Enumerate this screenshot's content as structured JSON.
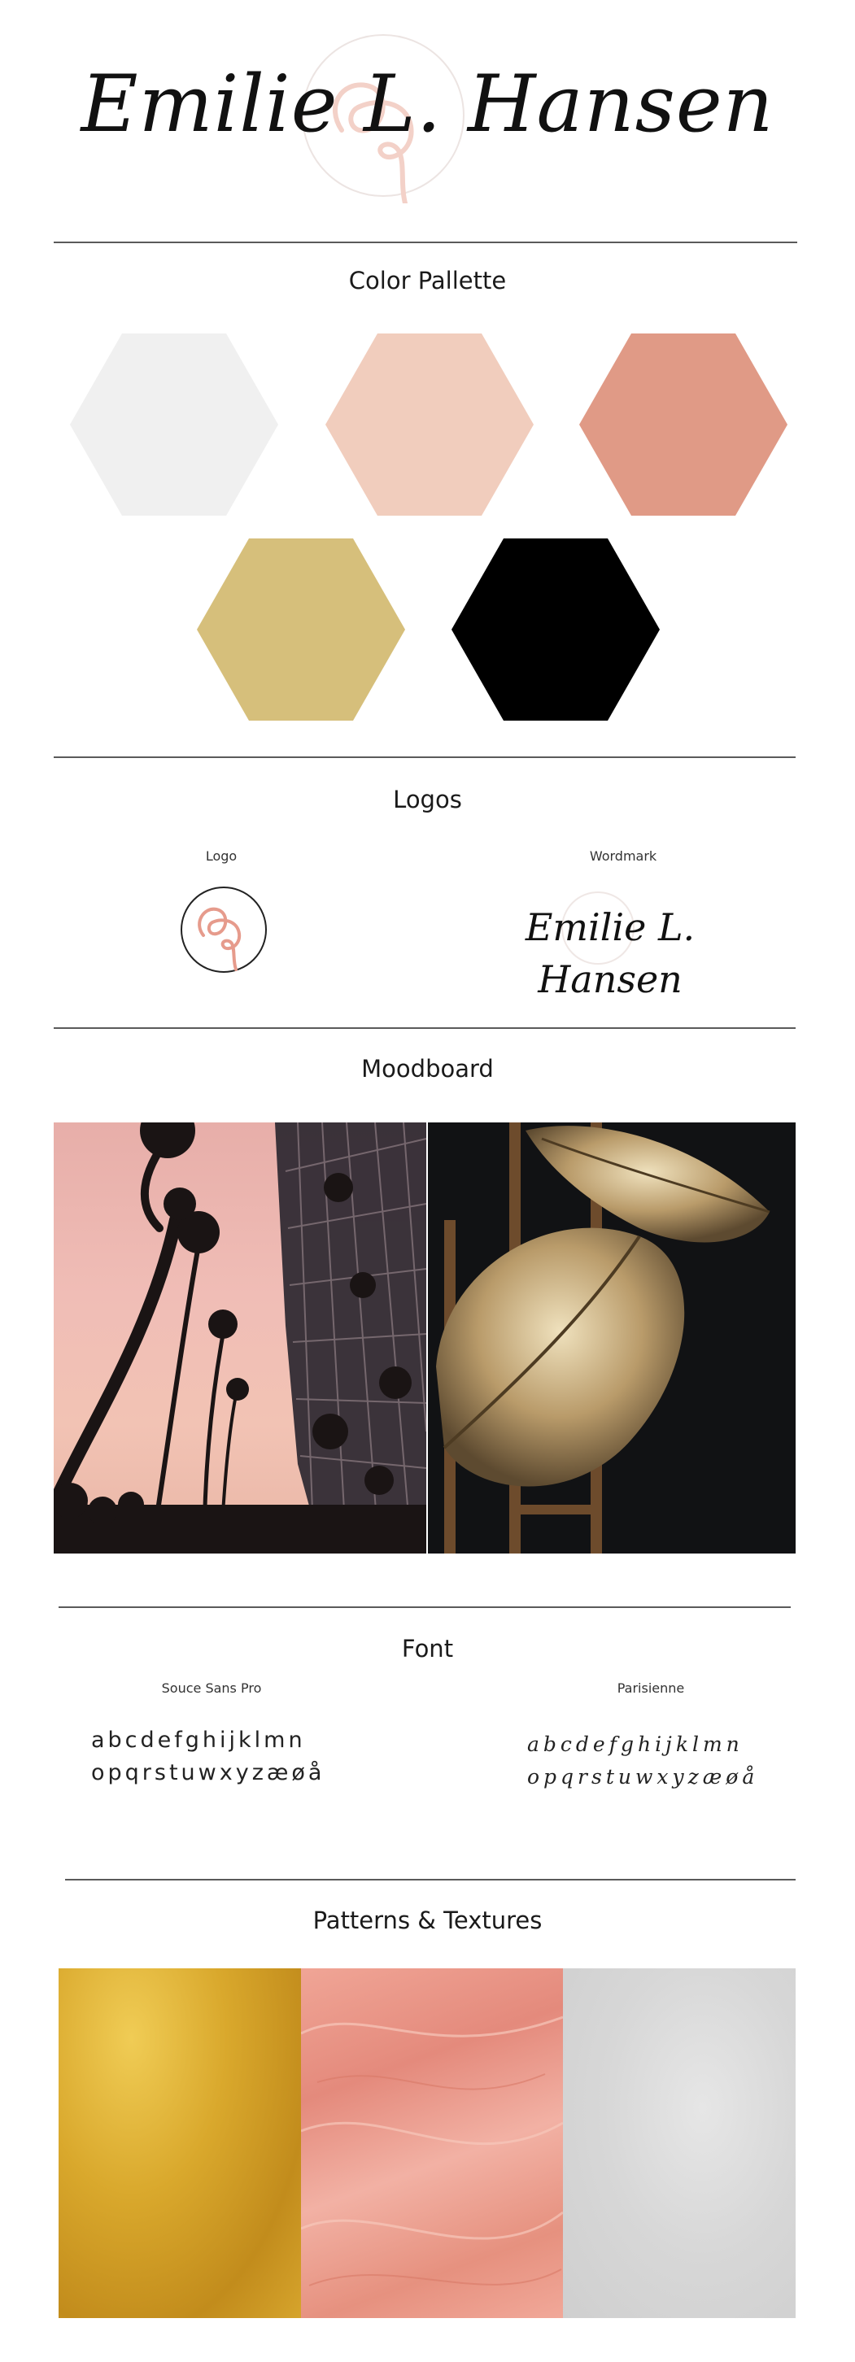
{
  "header": {
    "wordmark": "Emilie L. Hansen"
  },
  "colors": {
    "swatches": [
      {
        "name": "light-grey",
        "hex": "#f0f0f0"
      },
      {
        "name": "blush",
        "hex": "#f1cdbd"
      },
      {
        "name": "dusty-rose",
        "hex": "#e09a86"
      },
      {
        "name": "gold",
        "hex": "#d6bf7b"
      },
      {
        "name": "black",
        "hex": "#000000"
      }
    ],
    "accent": "#e8a79a"
  },
  "sections": {
    "color_palette": "Color Pallette",
    "logos": "Logos",
    "moodboard": "Moodboard",
    "font": "Font",
    "patterns": "Patterns & Textures"
  },
  "logos": {
    "logo_caption": "Logo",
    "wordmark_caption": "Wordmark",
    "wordmark_text": "Emilie L. Hansen"
  },
  "fonts": {
    "sans": {
      "name": "Souce Sans Pro",
      "line1": "abcdefghijklmn",
      "line2": "opqrstuwxyzæøå"
    },
    "script": {
      "name": "Parisienne",
      "line1": "abcdefghijklmn",
      "line2": "opqrstuwxyzæøå"
    }
  }
}
